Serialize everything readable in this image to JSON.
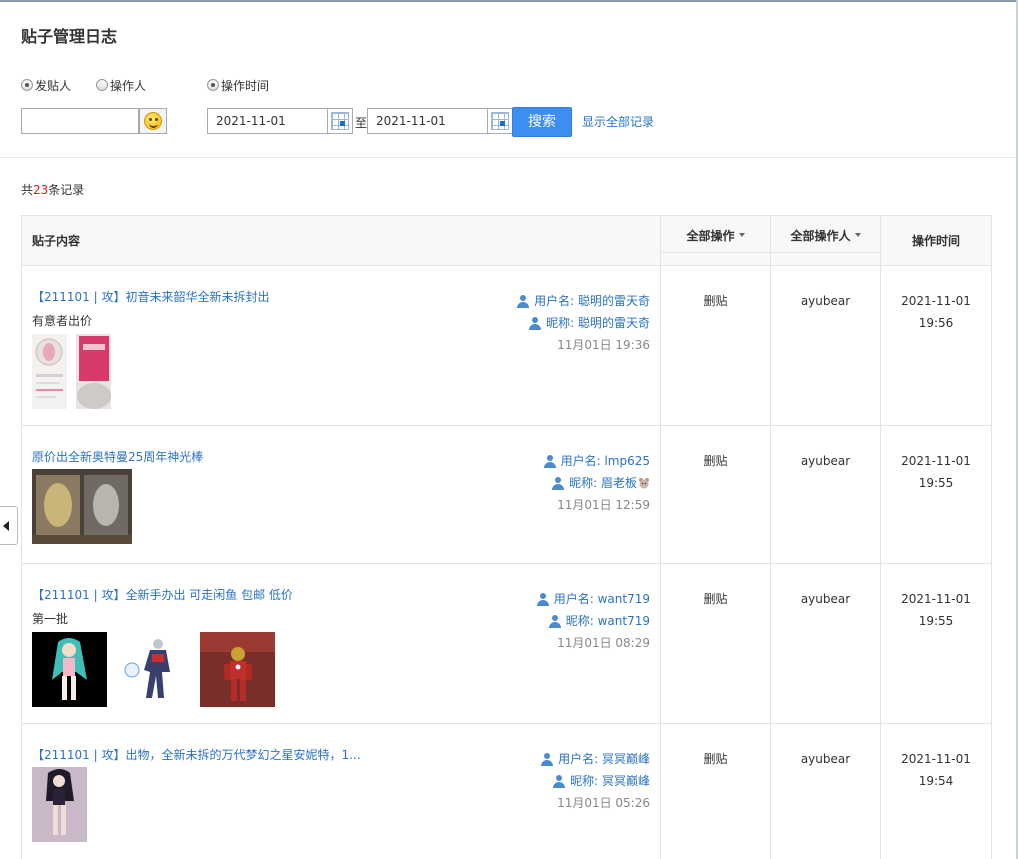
{
  "page": {
    "title": "贴子管理日志"
  },
  "filters": {
    "options": [
      {
        "label": "发贴人",
        "checked": true
      },
      {
        "label": "操作人",
        "checked": false
      },
      {
        "label": "操作时间",
        "checked": true
      }
    ],
    "keyword_value": "",
    "date_from": "2021-11-01",
    "date_to": "2021-11-01",
    "to_label": "至",
    "search_label": "搜索",
    "show_all_label": "显示全部记录"
  },
  "summary": {
    "prefix": "共",
    "count": "23",
    "suffix": "条记录"
  },
  "table": {
    "headers": {
      "content": "贴子内容",
      "operation": "全部操作",
      "operator": "全部操作人",
      "time": "操作时间"
    },
    "rows": [
      {
        "title": "【211101 | 攻】初音未来韶华全新未拆封出",
        "subtitle": "有意者出价",
        "username": "用户名: 聪明的雷天奇",
        "nickname": "昵称: 聪明的雷天奇",
        "post_time": "11月01日 19:36",
        "operation": "删贴",
        "operator": "ayubear",
        "date": "2021-11-01",
        "time": "19:56"
      },
      {
        "title": "原价出全新奥特曼25周年神光棒",
        "subtitle": "",
        "username": "用户名: lmp625",
        "nickname": "昵称: 眉老板",
        "post_time": "11月01日 12:59",
        "operation": "删贴",
        "operator": "ayubear",
        "date": "2021-11-01",
        "time": "19:55"
      },
      {
        "title": "【211101 | 攻】全新手办出 可走闲鱼 包邮 低价",
        "subtitle": "第一批",
        "username": "用户名: want719",
        "nickname": "昵称: want719",
        "post_time": "11月01日 08:29",
        "operation": "删贴",
        "operator": "ayubear",
        "date": "2021-11-01",
        "time": "19:55"
      },
      {
        "title": "【211101 | 攻】出物，全新未拆的万代梦幻之星安妮特，1...",
        "subtitle": "",
        "username": "用户名: 冥冥巅峰",
        "nickname": "昵称: 冥冥巅峰",
        "post_time": "11月01日 05:26",
        "operation": "删贴",
        "operator": "ayubear",
        "date": "2021-11-01",
        "time": "19:54"
      }
    ]
  }
}
